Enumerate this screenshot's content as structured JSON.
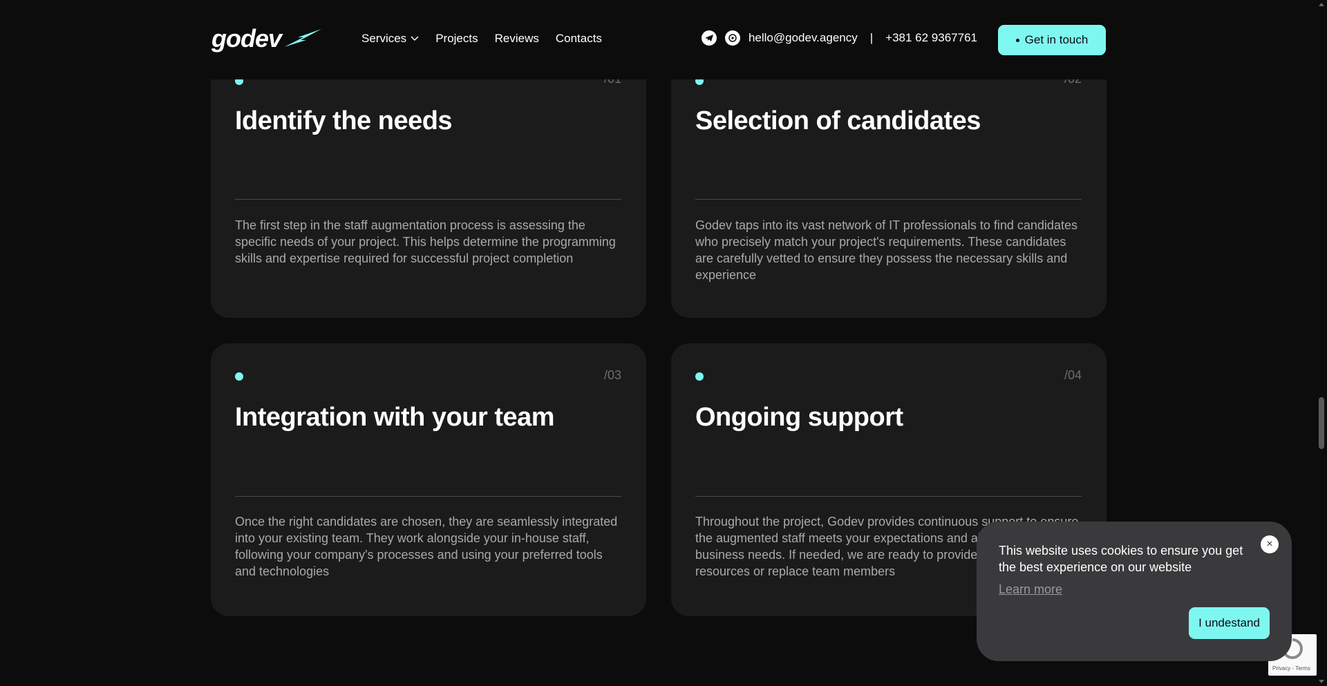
{
  "header": {
    "logo_text": "godev",
    "nav": [
      {
        "label": "Services"
      },
      {
        "label": "Projects"
      },
      {
        "label": "Reviews"
      },
      {
        "label": "Contacts"
      }
    ],
    "email": "hello@godev.agency",
    "separator": "|",
    "phone": "+381 62 9367761",
    "cta_label": "Get in touch"
  },
  "cards": [
    {
      "number": "/01",
      "title": "Identify the needs",
      "description": "The first step in the staff augmentation process is assessing the specific needs of your project. This helps determine the programming skills and expertise required for successful project completion"
    },
    {
      "number": "/02",
      "title": "Selection of candidates",
      "description": "Godev taps into its vast network of IT professionals to find candidates who precisely match your project's requirements. These candidates are carefully vetted to ensure they possess the necessary skills and experience"
    },
    {
      "number": "/03",
      "title": "Integration with your team",
      "description": "Once the right candidates are chosen, they are seamlessly integrated into your existing team. They work alongside your in-house staff, following your company's processes and using your preferred tools and technologies"
    },
    {
      "number": "/04",
      "title": "Ongoing support",
      "description": "Throughout the project, Godev provides continuous support to ensure the augmented staff meets your expectations and aligns with your business needs. If needed, we are ready to provide additional resources or replace team members"
    }
  ],
  "cookie": {
    "text": "This website uses cookies to ensure you get the best experience on our website",
    "learn_more": "Learn more",
    "button_label": "I undestand",
    "close_symbol": "×"
  },
  "recaptcha": {
    "footer_text": "Privacy - Terms"
  },
  "colors": {
    "background": "#0c0c0c",
    "card": "#1b1b1c",
    "accent": "#7ff7f1",
    "popup": "#3a3a3c"
  },
  "icons": {
    "telegram": "telegram-icon",
    "whatsapp": "whatsapp-icon",
    "chevron": "chevron-down-icon",
    "bolt": "logo-bolt-icon"
  }
}
